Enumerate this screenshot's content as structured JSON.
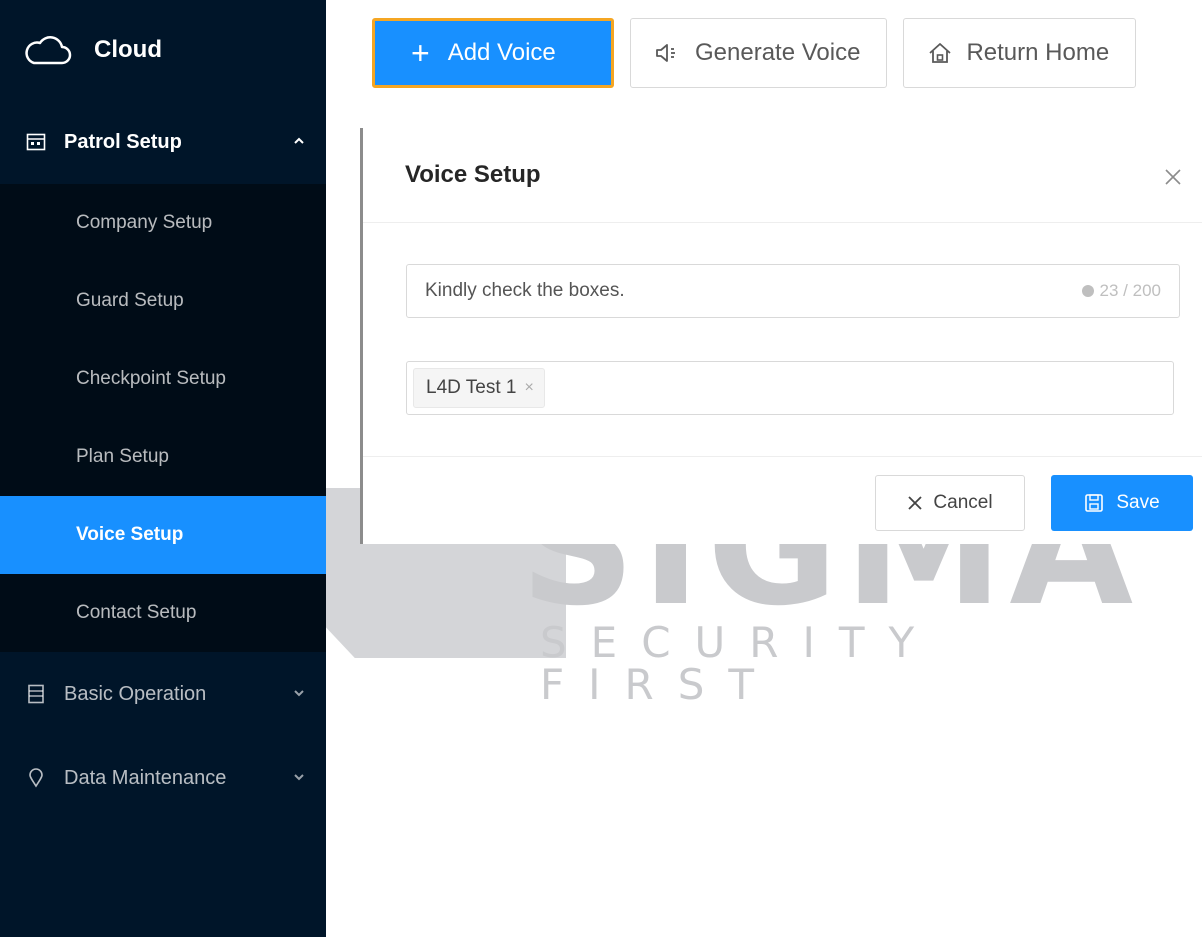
{
  "sidebar": {
    "brand": "Cloud",
    "groups": [
      {
        "label": "Patrol Setup",
        "icon": "calendar-icon",
        "expanded": true,
        "items": [
          "Company Setup",
          "Guard Setup",
          "Checkpoint Setup",
          "Plan Setup",
          "Voice Setup",
          "Contact Setup"
        ],
        "active_item": "Voice Setup"
      },
      {
        "label": "Basic Operation",
        "icon": "document-icon",
        "expanded": false
      },
      {
        "label": "Data Maintenance",
        "icon": "location-pin-icon",
        "expanded": false
      }
    ]
  },
  "toolbar": {
    "add_label": "Add Voice",
    "generate_label": "Generate Voice",
    "home_label": "Return Home"
  },
  "modal": {
    "title": "Voice Setup",
    "text_value": "Kindly check the boxes.",
    "char_count": "23 / 200",
    "selected_tags": [
      "L4D Test 1"
    ],
    "cancel_label": "Cancel",
    "save_label": "Save"
  },
  "watermark": {
    "word": "SIGMA",
    "tagline": "SECURITY FIRST"
  },
  "colors": {
    "sidebar_bg": "#001529",
    "submenu_bg": "#000c17",
    "primary": "#1890ff",
    "focus_outline": "#f5a623"
  }
}
